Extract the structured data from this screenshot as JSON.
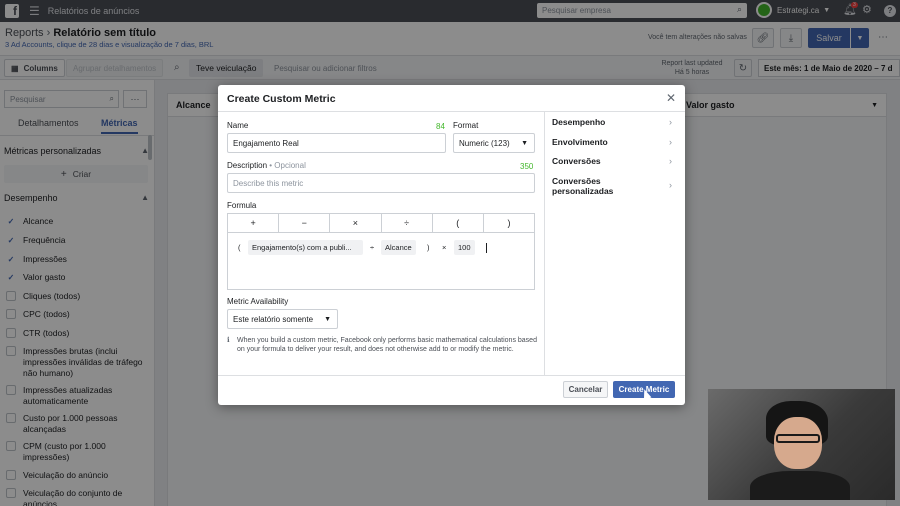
{
  "topbar": {
    "app_title": "Relatórios de anúncios",
    "search_placeholder": "Pesquisar empresa",
    "account_name": "Estrategi.ca",
    "notif_count": "3"
  },
  "header": {
    "breadcrumb_root": "Reports",
    "report_title": "Relatório sem título",
    "subtitle": "3 Ad Accounts, clique de 28 dias e visualização de 7 dias, BRL",
    "unsaved_text": "Você tem alterações não salvas",
    "save_label": "Salvar"
  },
  "toolbar": {
    "columns_label": "Columns",
    "group_label": "Agrupar detalhamentos",
    "filter_chip": "Teve veiculação",
    "filter_placeholder": "Pesquisar ou adicionar filtros",
    "last_updated_label": "Report last updated",
    "last_updated_value": "Há 5 horas",
    "date_range": "Este mês: 1 de Maio de 2020 – 7 d"
  },
  "sidebar": {
    "search_placeholder": "Pesquisar",
    "tab_breakdowns": "Detalhamentos",
    "tab_metrics": "Métricas",
    "custom_metrics_label": "Métricas personalizadas",
    "create_label": "Criar",
    "performance_label": "Desempenho",
    "items": [
      {
        "label": "Alcance",
        "checked": true
      },
      {
        "label": "Frequência",
        "checked": true
      },
      {
        "label": "Impressões",
        "checked": true
      },
      {
        "label": "Valor gasto",
        "checked": true
      },
      {
        "label": "Cliques (todos)",
        "checked": false
      },
      {
        "label": "CPC (todos)",
        "checked": false
      },
      {
        "label": "CTR (todos)",
        "checked": false
      },
      {
        "label": "Impressões brutas (inclui impressões inválidas de tráfego não humano)",
        "checked": false
      },
      {
        "label": "Impressões atualizadas automaticamente",
        "checked": false
      },
      {
        "label": "Custo por 1.000 pessoas alcançadas",
        "checked": false
      },
      {
        "label": "CPM (custo por 1.000 impressões)",
        "checked": false
      },
      {
        "label": "Veiculação do anúncio",
        "checked": false
      },
      {
        "label": "Veiculação do conjunto de anúncios",
        "checked": false
      }
    ]
  },
  "main": {
    "col_alcance": "Alcance",
    "col_valor_gasto": "Valor gasto"
  },
  "modal": {
    "title": "Create Custom Metric",
    "name_label": "Name",
    "name_value": "Engajamento Real",
    "name_count": "84",
    "format_label": "Format",
    "format_value": "Numeric (123)",
    "description_label": "Description",
    "description_optional": "• Opcional",
    "description_count": "350",
    "description_placeholder": "Describe this metric",
    "formula_label": "Formula",
    "operators": [
      "+",
      "−",
      "×",
      "÷",
      "(",
      ")"
    ],
    "formula_tokens": [
      "(",
      "Engajamento(s) com a publi...",
      "÷",
      "Alcance",
      ")",
      "×",
      "100"
    ],
    "availability_label": "Metric Availability",
    "availability_value": "Este relatório somente",
    "info_text": "When you build a custom metric, Facebook only performs basic mathematical calculations based on your formula to deliver your result, and does not otherwise add to or modify the metric.",
    "categories": [
      "Desempenho",
      "Envolvimento",
      "Conversões",
      "Conversões personalizadas"
    ],
    "cancel_label": "Cancelar",
    "create_label": "Create Metric"
  },
  "colors": {
    "brand_blue": "#4267b2",
    "topbar": "#4b4f56",
    "count_green": "#42b72a"
  }
}
